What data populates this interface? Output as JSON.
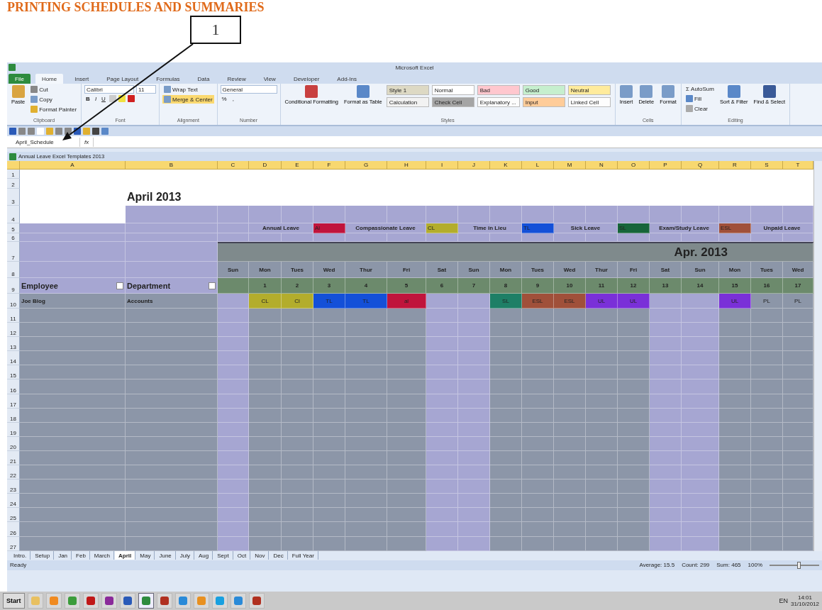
{
  "document": {
    "heading": "PRINTING SCHEDULES AND SUMMARIES",
    "callout": "1"
  },
  "window": {
    "title": "Microsoft Excel"
  },
  "ribbon_tabs": [
    {
      "label": "File",
      "selected": false
    },
    {
      "label": "Home",
      "selected": true
    },
    {
      "label": "Insert",
      "selected": false
    },
    {
      "label": "Page Layout",
      "selected": false
    },
    {
      "label": "Formulas",
      "selected": false
    },
    {
      "label": "Data",
      "selected": false
    },
    {
      "label": "Review",
      "selected": false
    },
    {
      "label": "View",
      "selected": false
    },
    {
      "label": "Developer",
      "selected": false
    },
    {
      "label": "Add-Ins",
      "selected": false
    }
  ],
  "ribbon": {
    "clipboard": {
      "title": "Clipboard",
      "paste": "Paste",
      "cut": "Cut",
      "copy": "Copy",
      "format_painter": "Format Painter"
    },
    "font": {
      "title": "Font",
      "name": "Calibri",
      "size": "11",
      "bold": "B",
      "italic": "I",
      "underline": "U"
    },
    "alignment": {
      "title": "Alignment",
      "wrap": "Wrap Text",
      "merge": "Merge & Center"
    },
    "number": {
      "title": "Number",
      "format": "General",
      "percent": "%",
      "comma": ","
    },
    "styles": {
      "title": "Styles",
      "conditional": "Conditional Formatting",
      "table": "Format as Table",
      "swatches": [
        {
          "label": "Style 1",
          "color": "#ddd9c4"
        },
        {
          "label": "Normal",
          "color": "#ffffff"
        },
        {
          "label": "Bad",
          "color": "#ffc7ce"
        },
        {
          "label": "Good",
          "color": "#c6efce"
        },
        {
          "label": "Neutral",
          "color": "#ffeb9c"
        },
        {
          "label": "Calculation",
          "color": "#f2f2f2"
        },
        {
          "label": "Check Cell",
          "color": "#a5a5a5"
        },
        {
          "label": "Explanatory ...",
          "color": "#fcfcfc"
        },
        {
          "label": "Input",
          "color": "#ffcc99"
        },
        {
          "label": "Linked Cell",
          "color": "#fdfdfd"
        }
      ]
    },
    "cells": {
      "title": "Cells",
      "buttons": [
        "Insert",
        "Delete",
        "Format"
      ]
    },
    "editing": {
      "title": "Editing",
      "sigma": "Σ",
      "autosum": "AutoSum",
      "fill": "Fill",
      "clear": "Clear",
      "sort": "Sort & Filter",
      "find": "Find & Select"
    }
  },
  "formula_bar": {
    "name_box": "April_Schedule",
    "fx": "fx"
  },
  "workbook": {
    "title": "Annual Leave Excel Templates 2013"
  },
  "sheet": {
    "columns": [
      "A",
      "B",
      "C",
      "D",
      "E",
      "F",
      "G",
      "H",
      "I",
      "J",
      "K",
      "L",
      "M",
      "N",
      "O",
      "P",
      "Q",
      "R",
      "S",
      "T"
    ],
    "title": "April 2013",
    "legend": [
      {
        "label": "Annual Leave",
        "code": "Al",
        "color": "#c0143c"
      },
      {
        "label": "Compassionate Leave",
        "code": "CL",
        "color": "#b3ad2c"
      },
      {
        "label": "Time in Lieu",
        "code": "TL",
        "color": "#1450d8"
      },
      {
        "label": "Sick Leave",
        "code": "SL",
        "color": "#17653a"
      },
      {
        "label": "Exam/Study Leave",
        "code": "ESL",
        "color": "#a0503a"
      },
      {
        "label": "Unpaid Leave"
      }
    ],
    "month_banner": "Apr. 2013",
    "headers": [
      "Employee",
      "Department"
    ],
    "days": [
      {
        "weekday": "Sun",
        "weekend": true
      },
      {
        "weekday": "Mon",
        "date": "1",
        "weekend": false
      },
      {
        "weekday": "Tues",
        "date": "2",
        "weekend": false
      },
      {
        "weekday": "Wed",
        "date": "3",
        "weekend": false
      },
      {
        "weekday": "Thur",
        "date": "4",
        "weekend": false
      },
      {
        "weekday": "Fri",
        "date": "5",
        "weekend": false
      },
      {
        "weekday": "Sat",
        "date": "6",
        "weekend": true
      },
      {
        "weekday": "Sun",
        "date": "7",
        "weekend": true
      },
      {
        "weekday": "Mon",
        "date": "8",
        "weekend": false
      },
      {
        "weekday": "Tues",
        "date": "9",
        "weekend": false
      },
      {
        "weekday": "Wed",
        "date": "10",
        "weekend": false
      },
      {
        "weekday": "Thur",
        "date": "11",
        "weekend": false
      },
      {
        "weekday": "Fri",
        "date": "12",
        "weekend": false
      },
      {
        "weekday": "Sat",
        "date": "13",
        "weekend": true
      },
      {
        "weekday": "Sun",
        "date": "14",
        "weekend": true
      },
      {
        "weekday": "Mon",
        "date": "15",
        "weekend": false
      },
      {
        "weekday": "Tues",
        "date": "16",
        "weekend": false
      },
      {
        "weekday": "Wed",
        "date": "17",
        "weekend": false
      }
    ],
    "employees": [
      {
        "row": "10",
        "name": "Joe Blog",
        "department": "Accounts",
        "entries": [
          {
            "kind": "off"
          },
          {
            "kind": "leave",
            "code": "CL",
            "color": "#b3ad2c"
          },
          {
            "kind": "leave",
            "code": "Cl",
            "color": "#b3ad2c"
          },
          {
            "kind": "leave",
            "code": "TL",
            "color": "#1450d8"
          },
          {
            "kind": "leave",
            "code": "TL",
            "color": "#1450d8"
          },
          {
            "kind": "leave",
            "code": "al",
            "color": "#c0143c"
          },
          {
            "kind": "off"
          },
          {
            "kind": "off"
          },
          {
            "kind": "leave",
            "code": "SL",
            "color": "#1e7f66"
          },
          {
            "kind": "leave",
            "code": "ESL",
            "color": "#a0503a"
          },
          {
            "kind": "leave",
            "code": "ESL",
            "color": "#a0503a"
          },
          {
            "kind": "leave",
            "code": "UL",
            "color": "#7a30d8"
          },
          {
            "kind": "leave",
            "code": "UL",
            "color": "#7a30d8"
          },
          {
            "kind": "off"
          },
          {
            "kind": "off"
          },
          {
            "kind": "leave",
            "code": "UL",
            "color": "#7a30d8"
          },
          {
            "kind": "leave",
            "code": "PL"
          },
          {
            "kind": "leave",
            "code": "PL"
          }
        ]
      }
    ],
    "top_rows": [
      "1",
      "2",
      "3",
      "4",
      "5",
      "6",
      "7",
      "8",
      "9"
    ],
    "empty_rows": [
      "11",
      "12",
      "13",
      "14",
      "15",
      "16",
      "17",
      "18",
      "19",
      "20",
      "21",
      "22",
      "23",
      "24",
      "25",
      "26",
      "27"
    ]
  },
  "sheet_tabs": [
    {
      "label": "Intro.",
      "selected": false
    },
    {
      "label": "Setup",
      "selected": false
    },
    {
      "label": "Jan",
      "selected": false
    },
    {
      "label": "Feb",
      "selected": false
    },
    {
      "label": "March",
      "selected": false
    },
    {
      "label": "April",
      "selected": true
    },
    {
      "label": "May",
      "selected": false
    },
    {
      "label": "June",
      "selected": false
    },
    {
      "label": "July",
      "selected": false
    },
    {
      "label": "Aug",
      "selected": false
    },
    {
      "label": "Sept",
      "selected": false
    },
    {
      "label": "Oct",
      "selected": false
    },
    {
      "label": "Nov",
      "selected": false
    },
    {
      "label": "Dec",
      "selected": false
    },
    {
      "label": "Full Year",
      "selected": false
    }
  ],
  "status_bar": {
    "ready": "Ready",
    "average": "Average: 15.5",
    "count": "Count: 299",
    "sum": "Sum: 465",
    "zoom": "100%",
    "zoom_level": {
      "level": 0.6
    }
  },
  "taskbar": {
    "start": "Start",
    "apps": [
      {
        "color": "#e8c060",
        "selected": false
      },
      {
        "color": "#f08a20",
        "selected": false
      },
      {
        "color": "#3b9c3b",
        "selected": false
      },
      {
        "color": "#c01818",
        "selected": false
      },
      {
        "color": "#8a2a9a",
        "selected": false
      },
      {
        "color": "#2a5ab8",
        "selected": false
      },
      {
        "color": "#2e8b3e",
        "selected": true
      },
      {
        "color": "#b03020",
        "selected": false
      },
      {
        "color": "#2a8ad8",
        "selected": false
      },
      {
        "color": "#e89020",
        "selected": false
      },
      {
        "color": "#18a0e0",
        "selected": false
      },
      {
        "color": "#2a8ad8",
        "selected": false
      },
      {
        "color": "#b03020",
        "selected": false
      }
    ],
    "language": "EN",
    "time": "14:01",
    "date": "31/10/2012"
  }
}
